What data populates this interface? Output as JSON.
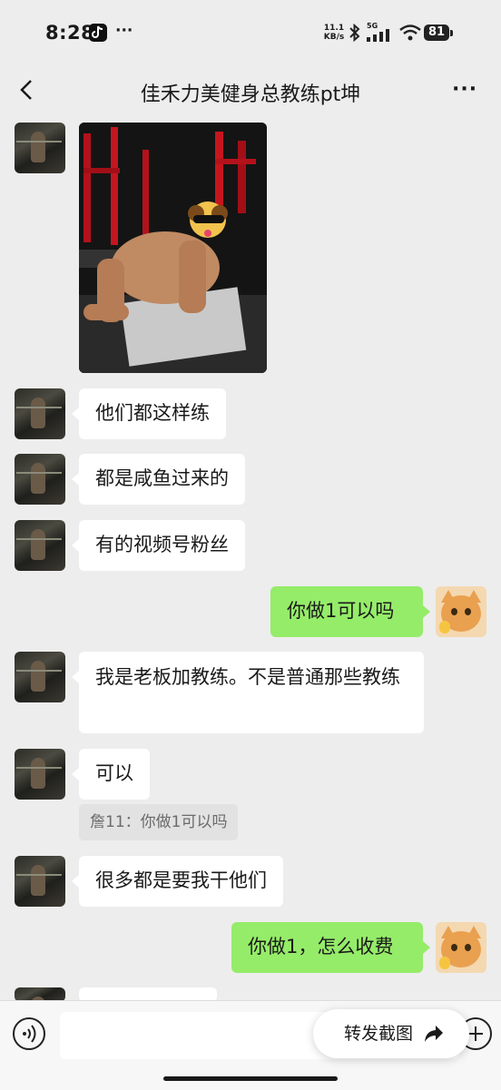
{
  "status_bar": {
    "time": "8:28",
    "net_speed_value": "11.1",
    "net_speed_unit": "KB/s",
    "network": "5G",
    "battery": "81"
  },
  "header": {
    "title": "佳禾力美健身总教练pt坤"
  },
  "messages": [
    {
      "side": "left",
      "type": "image"
    },
    {
      "side": "left",
      "type": "text",
      "text": "他们都这样练"
    },
    {
      "side": "left",
      "type": "text",
      "text": "都是咸鱼过来的"
    },
    {
      "side": "left",
      "type": "text",
      "text": "有的视频号粉丝"
    },
    {
      "side": "right",
      "type": "text",
      "text": "你做1可以吗"
    },
    {
      "side": "left",
      "type": "text",
      "text": "我是老板加教练。不是普通那些教练"
    },
    {
      "side": "left",
      "type": "text",
      "text": "可以",
      "quote": "詹11：你做1可以吗"
    },
    {
      "side": "left",
      "type": "text",
      "text": "很多都是要我干他们"
    },
    {
      "side": "right",
      "type": "text",
      "text": "你做1，怎么收费"
    }
  ],
  "forward_button": {
    "label": "转发截图"
  },
  "colors": {
    "background": "#ededed",
    "sent_bubble": "#95ec69",
    "received_bubble": "#ffffff"
  },
  "icons": [
    "back-icon",
    "more-icon",
    "voice-icon",
    "plus-icon",
    "share-arrow-icon",
    "bluetooth-icon",
    "signal-icon",
    "wifi-icon",
    "tiktok-icon"
  ]
}
